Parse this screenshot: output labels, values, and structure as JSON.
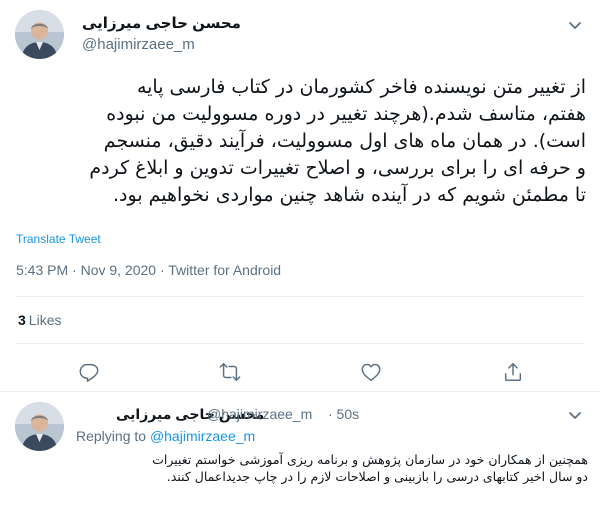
{
  "tweet": {
    "author_name": "محسن حاجی میرزایی",
    "author_handle": "@hajimirzaee_m",
    "text_lines": [
      "از تغییر متن نویسنده فاخر کشورمان در کتاب فارسی پایه",
      "هفتم، متاسف شدم.(هرچند تغییر در دوره مسوولیت من نبوده",
      "است). در همان ماه های اول  مسوولیت، فرآیند دقیق، منسجم",
      "و حرفه ای را برای بررسی، و اصلاح  تغییرات تدوین و ابلاغ کردم",
      "تا مطمئن شویم که در آینده شاهد چنین مواردی نخواهیم بود."
    ],
    "translate_label": "Translate Tweet",
    "timestamp": "5:43 PM · Nov 9, 2020 · Twitter for Android",
    "likes_count": "3",
    "likes_label": "Likes"
  },
  "actions": [
    {
      "icon": "reply-icon"
    },
    {
      "icon": "retweet-icon"
    },
    {
      "icon": "like-icon"
    },
    {
      "icon": "share-icon"
    }
  ],
  "reply": {
    "author_name": "محسن حاجی میرزایی",
    "author_handle": "@hajimirzaee_m",
    "time": "· 50s",
    "replying_prefix": "Replying to",
    "replying_handle": "@hajimirzaee_m",
    "text_lines": [
      "همچنین از همکاران خود در سازمان پژوهش و برنامه ریزی آموزشی خواستم  تغییرات",
      "دو سال اخیر کتابهای درسی را بازبینی و اصلاحات لازم را در چاپ جدیداعمال  کنند."
    ]
  },
  "colors": {
    "text": "#0f1419",
    "secondary": "#5b7083",
    "accent": "#1b95e0",
    "divider": "#e6ecf0"
  }
}
